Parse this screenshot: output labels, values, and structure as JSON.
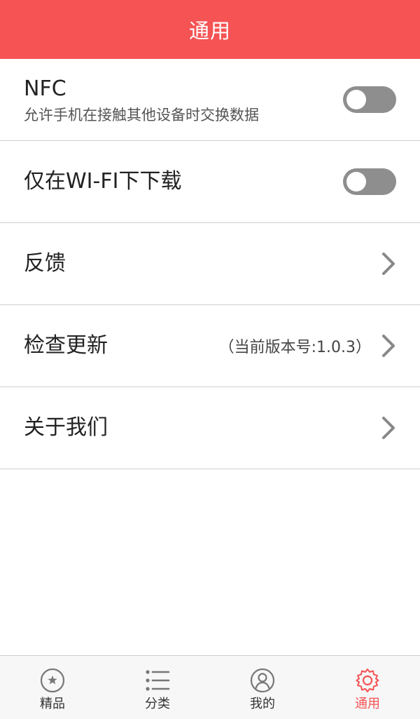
{
  "header": {
    "title": "通用"
  },
  "settings": {
    "nfc": {
      "label": "NFC",
      "description": "允许手机在接触其他设备时交换数据",
      "enabled": false
    },
    "wifi_only": {
      "label": "仅在WI-FI下下载",
      "enabled": false
    },
    "feedback": {
      "label": "反馈"
    },
    "check_update": {
      "label": "检查更新",
      "value": "（当前版本号:1.0.3）"
    },
    "about": {
      "label": "关于我们"
    }
  },
  "tabbar": {
    "items": [
      {
        "label": "精品",
        "icon": "star-circle-icon",
        "active": false
      },
      {
        "label": "分类",
        "icon": "list-icon",
        "active": false
      },
      {
        "label": "我的",
        "icon": "user-circle-icon",
        "active": false
      },
      {
        "label": "通用",
        "icon": "gear-icon",
        "active": true
      }
    ]
  },
  "colors": {
    "accent": "#f55354",
    "toggle_off": "#8e8e8e",
    "divider": "#cfcfcf",
    "tab_icon": "#777777"
  }
}
